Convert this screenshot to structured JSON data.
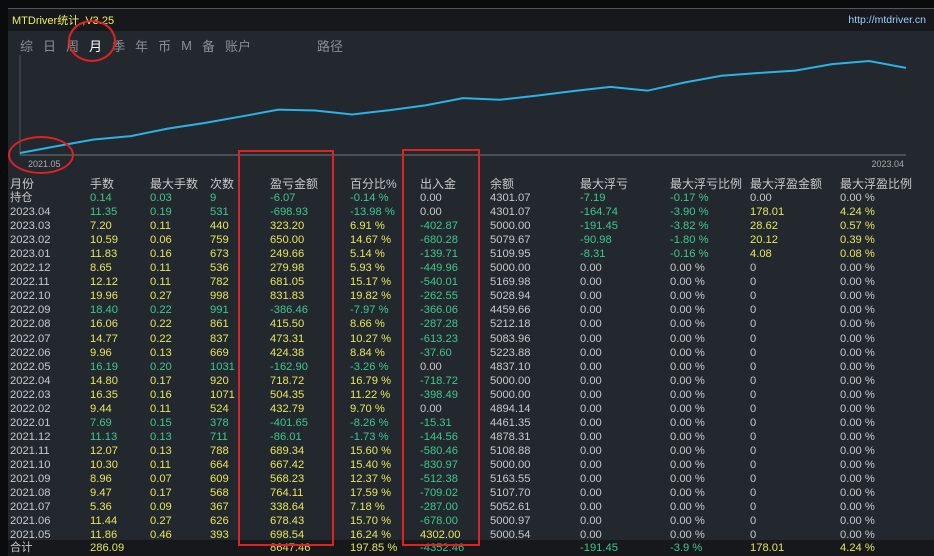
{
  "window": {
    "title": "MTDriver统计 ,V3.25",
    "url": "http://mtdriver.cn"
  },
  "tabs": [
    "综",
    "日",
    "周",
    "月",
    "季",
    "年",
    "币",
    "M",
    "备",
    "账户"
  ],
  "active_tab": "月",
  "path_label": "路径",
  "chart": {
    "start_label": "2021.05",
    "end_label": "2023.04",
    "line_color": "#2ab3e6"
  },
  "columns": [
    "月份",
    "手数",
    "最大手数",
    "次数",
    "盈亏金额",
    "百分比%",
    "出入金",
    "余额",
    "最大浮亏",
    "最大浮亏比例",
    "最大浮盈金额",
    "最大浮盈比例"
  ],
  "rows": [
    [
      "持仓",
      "0.14",
      "0.03",
      "9",
      "-6.07",
      "-0.14 %",
      "0.00",
      "4301.07",
      "-7.19",
      "-0.17 %",
      "0.00",
      "0.00 %"
    ],
    [
      "2023.04",
      "11.35",
      "0.19",
      "531",
      "-698.93",
      "-13.98 %",
      "0.00",
      "4301.07",
      "-164.74",
      "-3.90 %",
      "178.01",
      "4.24 %"
    ],
    [
      "2023.03",
      "7.20",
      "0.11",
      "440",
      "323.20",
      "6.91 %",
      "-402.87",
      "5000.00",
      "-191.45",
      "-3.82 %",
      "28.62",
      "0.57 %"
    ],
    [
      "2023.02",
      "10.59",
      "0.06",
      "759",
      "650.00",
      "14.67 %",
      "-680.28",
      "5079.67",
      "-90.98",
      "-1.80 %",
      "20.12",
      "0.39 %"
    ],
    [
      "2023.01",
      "11.83",
      "0.16",
      "673",
      "249.66",
      "5.14 %",
      "-139.71",
      "5109.95",
      "-8.31",
      "-0.16 %",
      "4.08",
      "0.08 %"
    ],
    [
      "2022.12",
      "8.65",
      "0.11",
      "536",
      "279.98",
      "5.93 %",
      "-449.96",
      "5000.00",
      "0.00",
      "0.00 %",
      "0",
      "0.00 %"
    ],
    [
      "2022.11",
      "12.12",
      "0.11",
      "782",
      "681.05",
      "15.17 %",
      "-540.01",
      "5169.98",
      "0.00",
      "0.00 %",
      "0",
      "0.00 %"
    ],
    [
      "2022.10",
      "19.96",
      "0.27",
      "998",
      "831.83",
      "19.82 %",
      "-262.55",
      "5028.94",
      "0.00",
      "0.00 %",
      "0",
      "0.00 %"
    ],
    [
      "2022.09",
      "18.40",
      "0.22",
      "991",
      "-386.46",
      "-7.97 %",
      "-366.06",
      "4459.66",
      "0.00",
      "0.00 %",
      "0",
      "0.00 %"
    ],
    [
      "2022.08",
      "16.06",
      "0.22",
      "861",
      "415.50",
      "8.66 %",
      "-287.28",
      "5212.18",
      "0.00",
      "0.00 %",
      "0",
      "0.00 %"
    ],
    [
      "2022.07",
      "14.77",
      "0.22",
      "837",
      "473.31",
      "10.27 %",
      "-613.23",
      "5083.96",
      "0.00",
      "0.00 %",
      "0",
      "0.00 %"
    ],
    [
      "2022.06",
      "9.96",
      "0.13",
      "669",
      "424.38",
      "8.84 %",
      "-37.60",
      "5223.88",
      "0.00",
      "0.00 %",
      "0",
      "0.00 %"
    ],
    [
      "2022.05",
      "16.19",
      "0.20",
      "1031",
      "-162.90",
      "-3.26 %",
      "0.00",
      "4837.10",
      "0.00",
      "0.00 %",
      "0",
      "0.00 %"
    ],
    [
      "2022.04",
      "14.80",
      "0.17",
      "920",
      "718.72",
      "16.79 %",
      "-718.72",
      "5000.00",
      "0.00",
      "0.00 %",
      "0",
      "0.00 %"
    ],
    [
      "2022.03",
      "16.35",
      "0.16",
      "1071",
      "504.35",
      "11.22 %",
      "-398.49",
      "5000.00",
      "0.00",
      "0.00 %",
      "0",
      "0.00 %"
    ],
    [
      "2022.02",
      "9.44",
      "0.11",
      "524",
      "432.79",
      "9.70 %",
      "0.00",
      "4894.14",
      "0.00",
      "0.00 %",
      "0",
      "0.00 %"
    ],
    [
      "2022.01",
      "7.69",
      "0.15",
      "378",
      "-401.65",
      "-8.26 %",
      "-15.31",
      "4461.35",
      "0.00",
      "0.00 %",
      "0",
      "0.00 %"
    ],
    [
      "2021.12",
      "11.13",
      "0.13",
      "711",
      "-86.01",
      "-1.73 %",
      "-144.56",
      "4878.31",
      "0.00",
      "0.00 %",
      "0",
      "0.00 %"
    ],
    [
      "2021.11",
      "12.07",
      "0.13",
      "788",
      "689.34",
      "15.60 %",
      "-580.46",
      "5108.88",
      "0.00",
      "0.00 %",
      "0",
      "0.00 %"
    ],
    [
      "2021.10",
      "10.30",
      "0.11",
      "664",
      "667.42",
      "15.40 %",
      "-830.97",
      "5000.00",
      "0.00",
      "0.00 %",
      "0",
      "0.00 %"
    ],
    [
      "2021.09",
      "8.96",
      "0.07",
      "609",
      "568.23",
      "12.37 %",
      "-512.38",
      "5163.55",
      "0.00",
      "0.00 %",
      "0",
      "0.00 %"
    ],
    [
      "2021.08",
      "9.47",
      "0.17",
      "568",
      "764.11",
      "17.59 %",
      "-709.02",
      "5107.70",
      "0.00",
      "0.00 %",
      "0",
      "0.00 %"
    ],
    [
      "2021.07",
      "5.36",
      "0.09",
      "367",
      "338.64",
      "7.18 %",
      "-287.00",
      "5052.61",
      "0.00",
      "0.00 %",
      "0",
      "0.00 %"
    ],
    [
      "2021.06",
      "11.44",
      "0.27",
      "626",
      "678.43",
      "15.70 %",
      "-678.00",
      "5000.97",
      "0.00",
      "0.00 %",
      "0",
      "0.00 %"
    ],
    [
      "2021.05",
      "11.86",
      "0.46",
      "393",
      "698.54",
      "16.24 %",
      "4302.00",
      "5000.54",
      "0.00",
      "0.00 %",
      "0",
      "0.00 %"
    ]
  ],
  "total": [
    "合计",
    "286.09",
    "",
    "",
    "8647.46",
    "197.85 %",
    "-4352.46",
    "",
    "-191.45",
    "-3.9 %",
    "178.01",
    "4.24 %"
  ]
}
